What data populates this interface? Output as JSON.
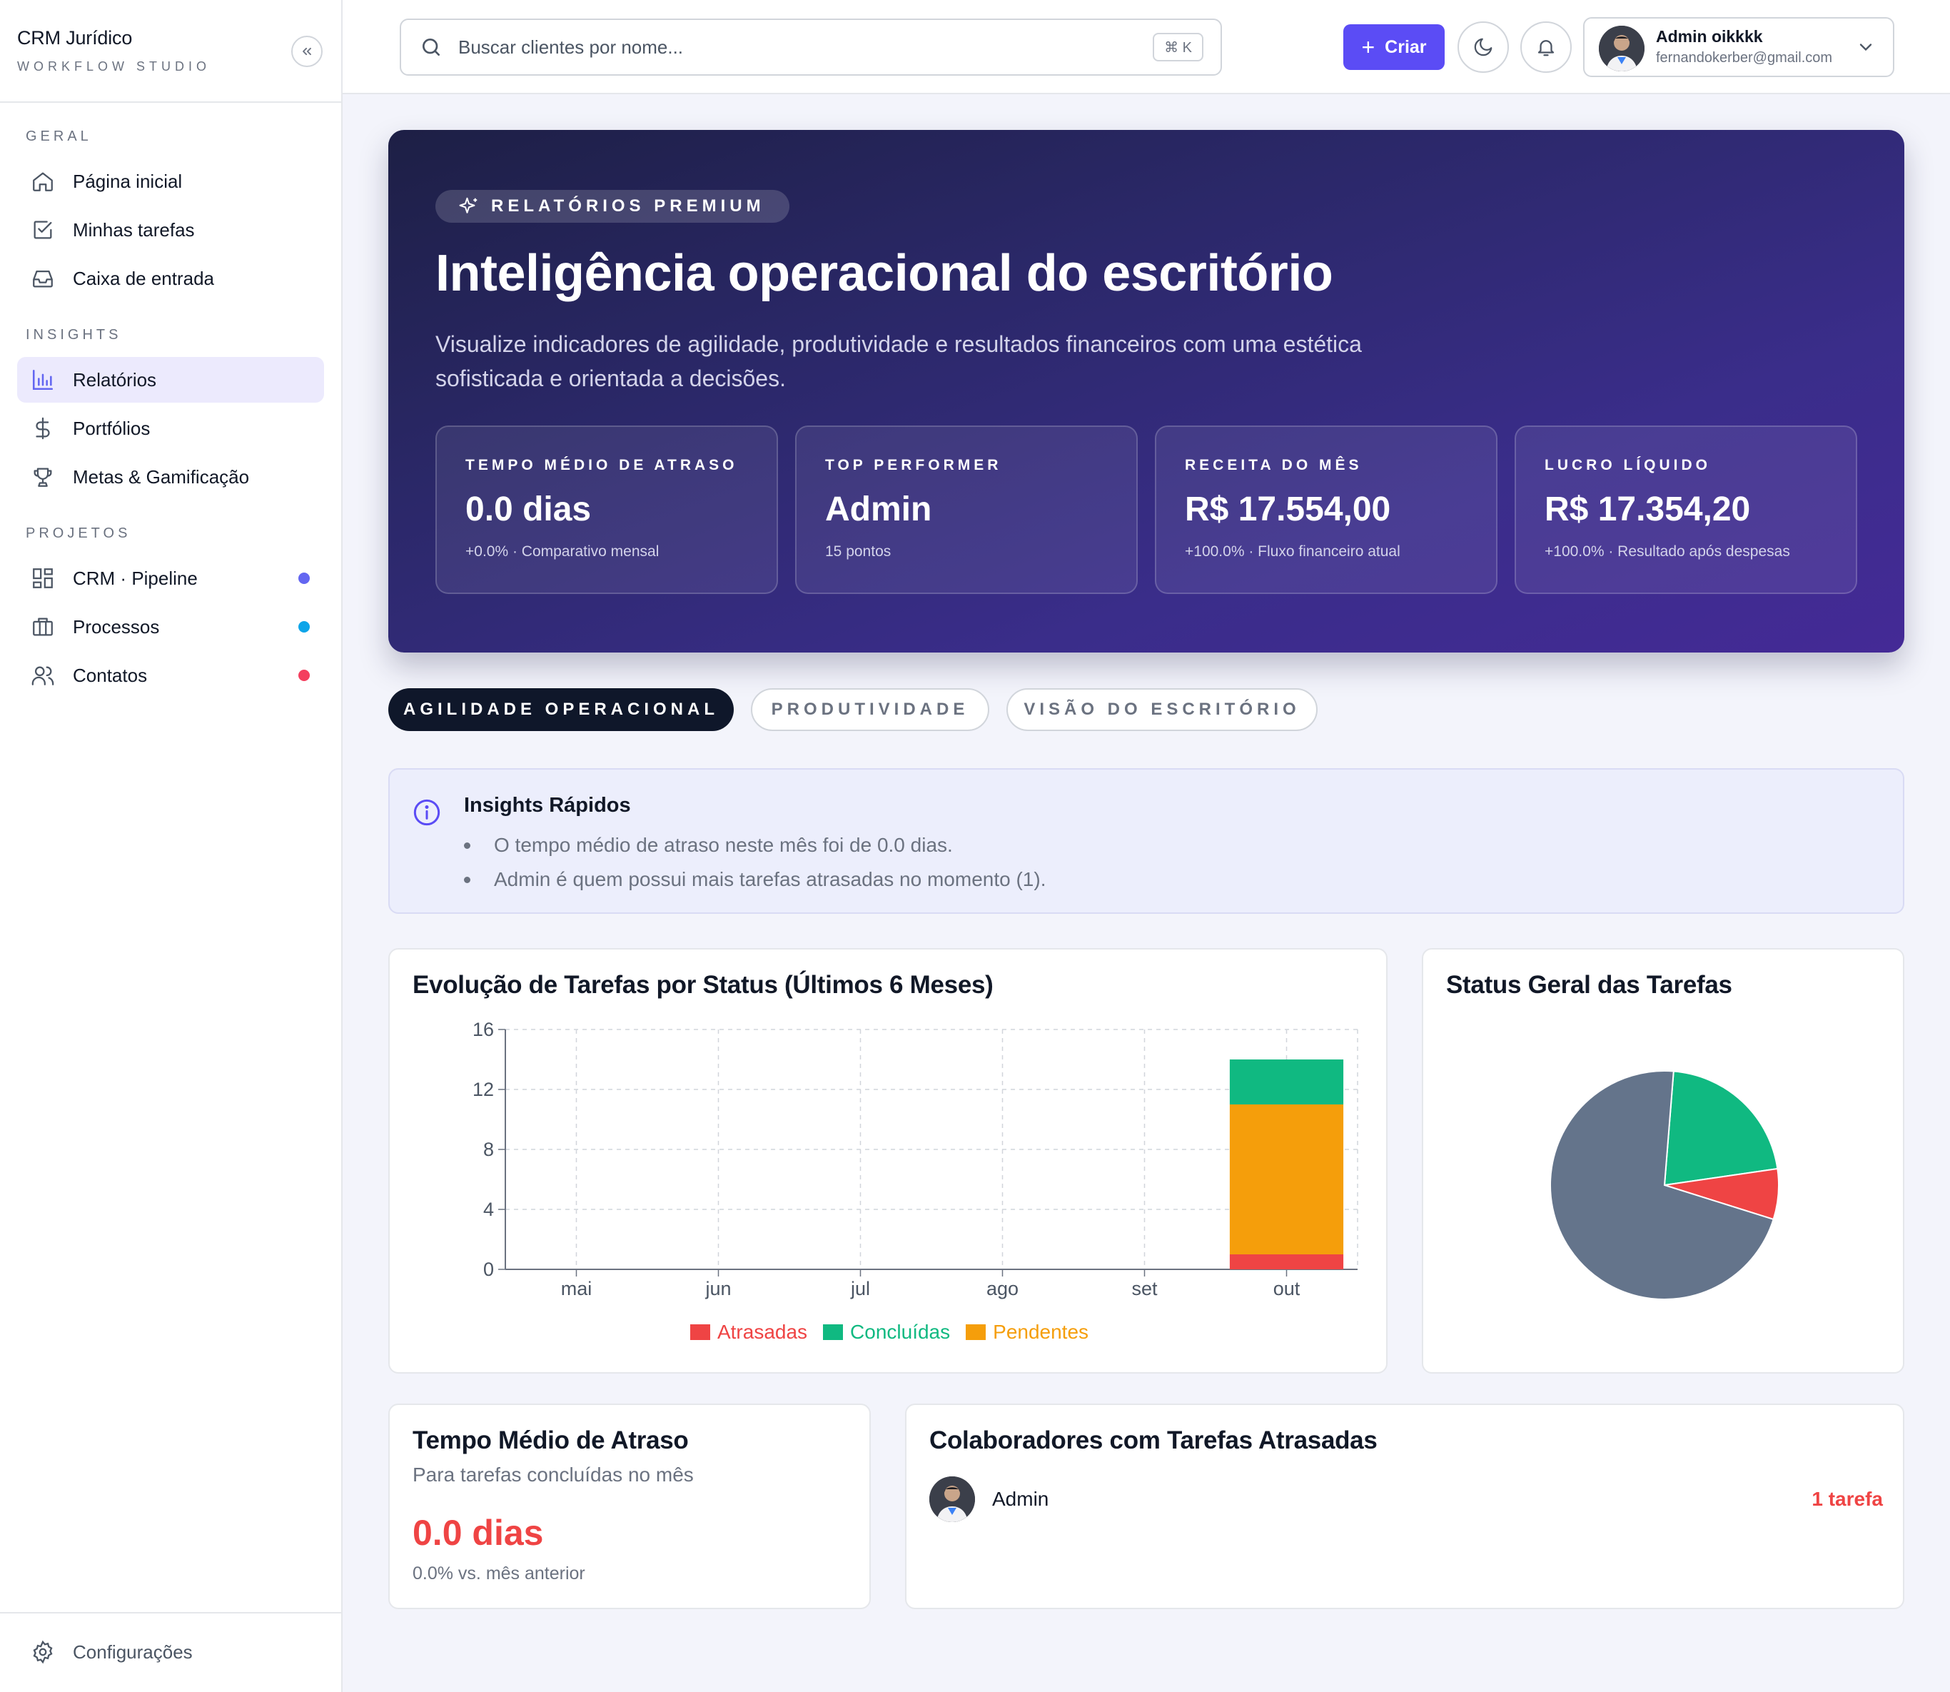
{
  "sidebar": {
    "brand_title": "CRM Jurídico",
    "brand_subtitle": "WORKFLOW STUDIO",
    "sections": {
      "geral": "GERAL",
      "insights": "INSIGHTS",
      "projetos": "PROJETOS"
    },
    "items": [
      {
        "label": "Página inicial",
        "icon": "home-icon"
      },
      {
        "label": "Minhas tarefas",
        "icon": "checkbox-icon"
      },
      {
        "label": "Caixa de entrada",
        "icon": "inbox-icon"
      },
      {
        "label": "Relatórios",
        "icon": "bar-chart-icon",
        "active": true
      },
      {
        "label": "Portfólios",
        "icon": "dollar-icon"
      },
      {
        "label": "Metas & Gamificação",
        "icon": "trophy-icon"
      },
      {
        "label": "CRM · Pipeline",
        "icon": "grid-icon",
        "dot": "#6366f1"
      },
      {
        "label": "Processos",
        "icon": "briefcase-icon",
        "dot": "#0ea5e9"
      },
      {
        "label": "Contatos",
        "icon": "users-icon",
        "dot": "#f43f5e"
      }
    ],
    "footer_label": "Configurações"
  },
  "topbar": {
    "search_placeholder": "Buscar clientes por nome...",
    "shortcut": "⌘ K",
    "create_label": "Criar",
    "user_name": "Admin oikkkk",
    "user_email": "fernandokerber@gmail.com"
  },
  "hero": {
    "badge": "RELATÓRIOS PREMIUM",
    "title": "Inteligência operacional do escritório",
    "description": "Visualize indicadores de agilidade, produtividade e resultados financeiros com uma estética sofisticada e orientada a decisões.",
    "kpis": [
      {
        "label": "TEMPO MÉDIO DE ATRASO",
        "value": "0.0 dias",
        "sub": "+0.0% · Comparativo mensal"
      },
      {
        "label": "TOP PERFORMER",
        "value": "Admin",
        "sub": "15 pontos"
      },
      {
        "label": "RECEITA DO MÊS",
        "value": "R$ 17.554,00",
        "sub": "+100.0% · Fluxo financeiro atual"
      },
      {
        "label": "LUCRO LÍQUIDO",
        "value": "R$ 17.354,20",
        "sub": "+100.0% · Resultado após despesas"
      }
    ]
  },
  "tabs": [
    {
      "label": "AGILIDADE OPERACIONAL",
      "active": true
    },
    {
      "label": "PRODUTIVIDADE",
      "active": false
    },
    {
      "label": "VISÃO DO ESCRITÓRIO",
      "active": false
    }
  ],
  "insights": {
    "title": "Insights Rápidos",
    "items": [
      "O tempo médio de atraso neste mês foi de 0.0 dias.",
      "Admin é quem possui mais tarefas atrasadas no momento (1)."
    ]
  },
  "evolution_card": {
    "title": "Evolução de Tarefas por Status (Últimos 6 Meses)"
  },
  "status_card": {
    "title": "Status Geral das Tarefas"
  },
  "delay_card": {
    "title": "Tempo Médio de Atraso",
    "subtitle": "Para tarefas concluídas no mês",
    "value": "0.0 dias",
    "comparison": "0.0% vs. mês anterior"
  },
  "collab_card": {
    "title": "Colaboradores com Tarefas Atrasadas",
    "rows": [
      {
        "name": "Admin",
        "count": "1 tarefa"
      }
    ]
  },
  "chart_data": [
    {
      "type": "bar",
      "stacked": true,
      "categories": [
        "mai",
        "jun",
        "jul",
        "ago",
        "set",
        "out"
      ],
      "series": [
        {
          "name": "Atrasadas",
          "color": "#ef4444",
          "values": [
            0,
            0,
            0,
            0,
            0,
            1
          ]
        },
        {
          "name": "Pendentes",
          "color": "#f59e0b",
          "values": [
            0,
            0,
            0,
            0,
            0,
            10
          ]
        },
        {
          "name": "Concluídas",
          "color": "#10b981",
          "values": [
            0,
            0,
            0,
            0,
            0,
            3
          ]
        }
      ],
      "legend_order": [
        "Atrasadas",
        "Concluídas",
        "Pendentes"
      ],
      "yticks": [
        0,
        4,
        8,
        12,
        16
      ],
      "ylim": [
        0,
        16
      ],
      "grid": true,
      "legend": "bottom"
    },
    {
      "type": "pie",
      "slices": [
        {
          "color": "#64748b",
          "value": 10
        },
        {
          "color": "#10b981",
          "value": 3
        },
        {
          "color": "#ef4444",
          "value": 1
        }
      ]
    }
  ]
}
